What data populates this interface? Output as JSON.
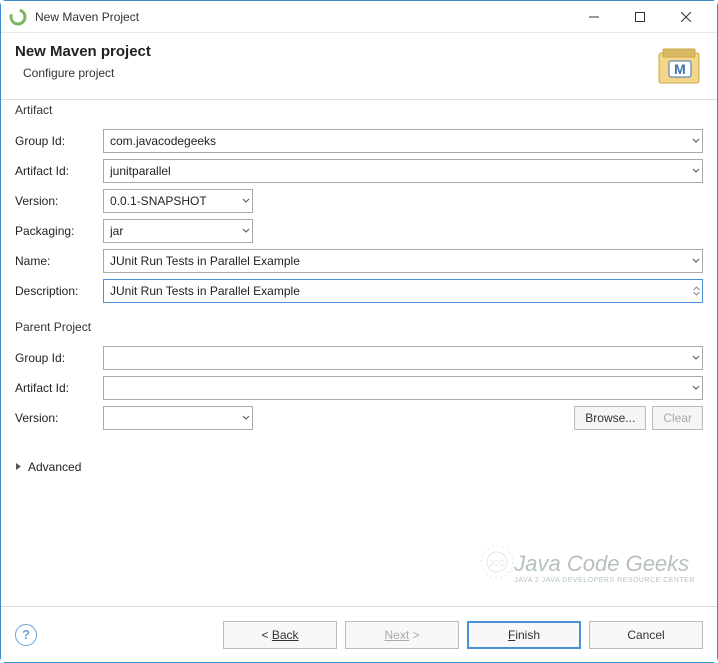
{
  "window": {
    "title": "New Maven Project"
  },
  "header": {
    "title": "New Maven project",
    "subtitle": "Configure project"
  },
  "artifact": {
    "legend": "Artifact",
    "groupIdLabel": "Group Id:",
    "groupId": "com.javacodegeeks",
    "artifactIdLabel": "Artifact Id:",
    "artifactId": "junitparallel",
    "versionLabel": "Version:",
    "version": "0.0.1-SNAPSHOT",
    "packagingLabel": "Packaging:",
    "packaging": "jar",
    "nameLabel": "Name:",
    "name": "JUnit Run Tests in Parallel Example",
    "descriptionLabel": "Description:",
    "description": "JUnit Run Tests in Parallel Example"
  },
  "parent": {
    "legend": "Parent Project",
    "groupIdLabel": "Group Id:",
    "groupId": "",
    "artifactIdLabel": "Artifact Id:",
    "artifactId": "",
    "versionLabel": "Version:",
    "version": "",
    "browseLabel": "Browse...",
    "clearLabel": "Clear"
  },
  "advanced": {
    "label": "Advanced"
  },
  "footer": {
    "back": "Back",
    "next": "Next",
    "finish": "Finish",
    "cancel": "Cancel"
  },
  "watermark": {
    "main": "Java Code Geeks",
    "sub": "Java 2 Java Developers Resource Center"
  }
}
